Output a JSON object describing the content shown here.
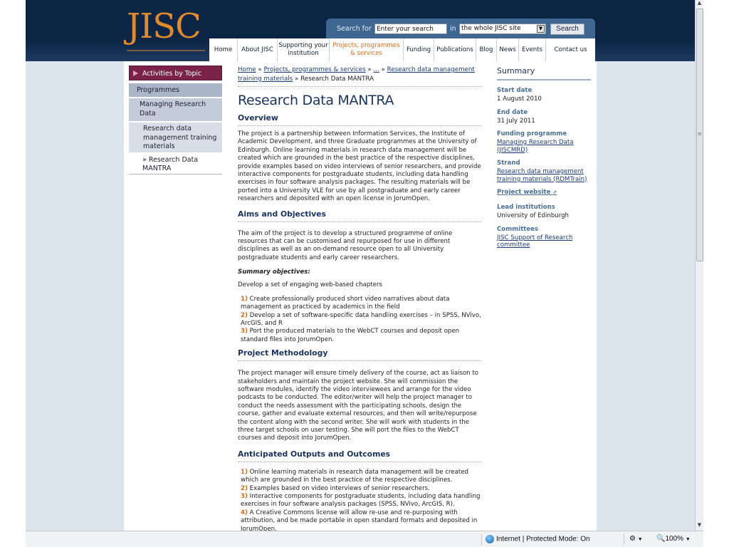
{
  "logo": "JISC",
  "search": {
    "label_for": "Search for",
    "input_value": "Enter your search",
    "label_in": "in",
    "scope": "the whole JISC site",
    "button": "Search"
  },
  "nav": [
    {
      "label": "Home"
    },
    {
      "label": "About JISC"
    },
    {
      "label": "Supporting your institution"
    },
    {
      "label": "Projects, programmes & services",
      "active": true
    },
    {
      "label": "Funding"
    },
    {
      "label": "Publications"
    },
    {
      "label": "Blog"
    },
    {
      "label": "News"
    },
    {
      "label": "Events"
    },
    {
      "label": "Contact us"
    }
  ],
  "sidebar": {
    "topic": "Activities by Topic",
    "level1": "Programmes",
    "level2": "Managing Research Data",
    "level3": "Research data management training materials",
    "level4_prefix": "»",
    "level4": "Research Data MANTRA"
  },
  "breadcrumb": {
    "home": "Home",
    "sep": "»",
    "projects": "Projects, programmes & services",
    "ellipsis": "...",
    "training": "Research data management training materials",
    "current": "Research Data MANTRA"
  },
  "main": {
    "title": "Research Data MANTRA",
    "overview_heading": "Overview",
    "overview_text": "The project is a partnership between Information Services, the Institute of Academic Development, and three Graduate programmes at the University of Edinburgh. Online learning materials in research data management will be created which are grounded in the best practice of the respective disciplines, provide examples based on video interviews of senior researchers, and provide interactive components for postgraduate students, including data handling exercises in four software analysis packages. The resulting materials will be ported into a University VLE for use by all postgraduate and early career researchers and deposited with an open license in JorumOpen.",
    "aims_heading": "Aims and Objectives",
    "aims_text": "The aim of the project is to develop a structured programme of online resources that can be customised and repurposed for use in different disciplines as well as an on-demand resource open to all University postgraduate students and early career researchers.",
    "summary_objectives_heading": "Summary objectives:",
    "summary_objectives_intro": "Develop a set of engaging web-based chapters",
    "objectives": [
      {
        "num": "1)",
        "text": "Create professionally produced short video narratives about data management as practiced by academics in the field"
      },
      {
        "num": "2)",
        "text": "Develop a set of software-specific data handling exercises – in SPSS, NVivo, ArcGIS, and R"
      },
      {
        "num": "3)",
        "text": "Port the produced materials to the WebCT courses and deposit open standard files into JorumOpen."
      }
    ],
    "methodology_heading": "Project Methodology",
    "methodology_text": "The project manager will ensure timely delivery of the course, act as liaison to stakeholders and maintain the project website. She will commission the software modules, identify the video interviewees and arrange for the video podcasts to be conducted. The editor/writer will help the project manager to conduct the needs assessment with the participating schools, design the course, gather and evaluate external resources, and then will write/repurpose the content along with the second writer. She will work with students in the three target schools on user testing. She will port the files to the WebCT courses and deposit into JorumOpen.",
    "outputs_heading": "Anticipated Outputs and Outcomes",
    "outputs": [
      {
        "num": "1)",
        "text": "Online learning materials in research data management will be created which are grounded in the best practice of the respective disciplines."
      },
      {
        "num": "2)",
        "text": "Examples based on video interviews of senior researchers."
      },
      {
        "num": "3)",
        "text": "Interactive components for postgraduate students, including data handling exercises in four software analysis packages (SPSS, NVivo, ArcGIS, R)."
      },
      {
        "num": "4)",
        "text": "A Creative Commons license will allow re-use and re-purposing with attribution, and be made portable in open standard formats and deposited in JorumOpen."
      }
    ]
  },
  "summary": {
    "title": "Summary",
    "start_label": "Start date",
    "start_value": "1 August 2010",
    "end_label": "End date",
    "end_value": "31 July 2011",
    "funding_label": "Funding programme",
    "funding_value": "Managing Research Data (JISCMRD)",
    "strand_label": "Strand",
    "strand_value": "Research data management training materials (RDMTrain)",
    "website": "Project website",
    "lead_label": "Lead institutions",
    "lead_value": "University of Edinburgh",
    "committees_label": "Committees",
    "committees_value": "JISC Support of Research committee"
  },
  "statusbar": {
    "zone": "Internet | Protected Mode: On",
    "zoom": "100%"
  }
}
